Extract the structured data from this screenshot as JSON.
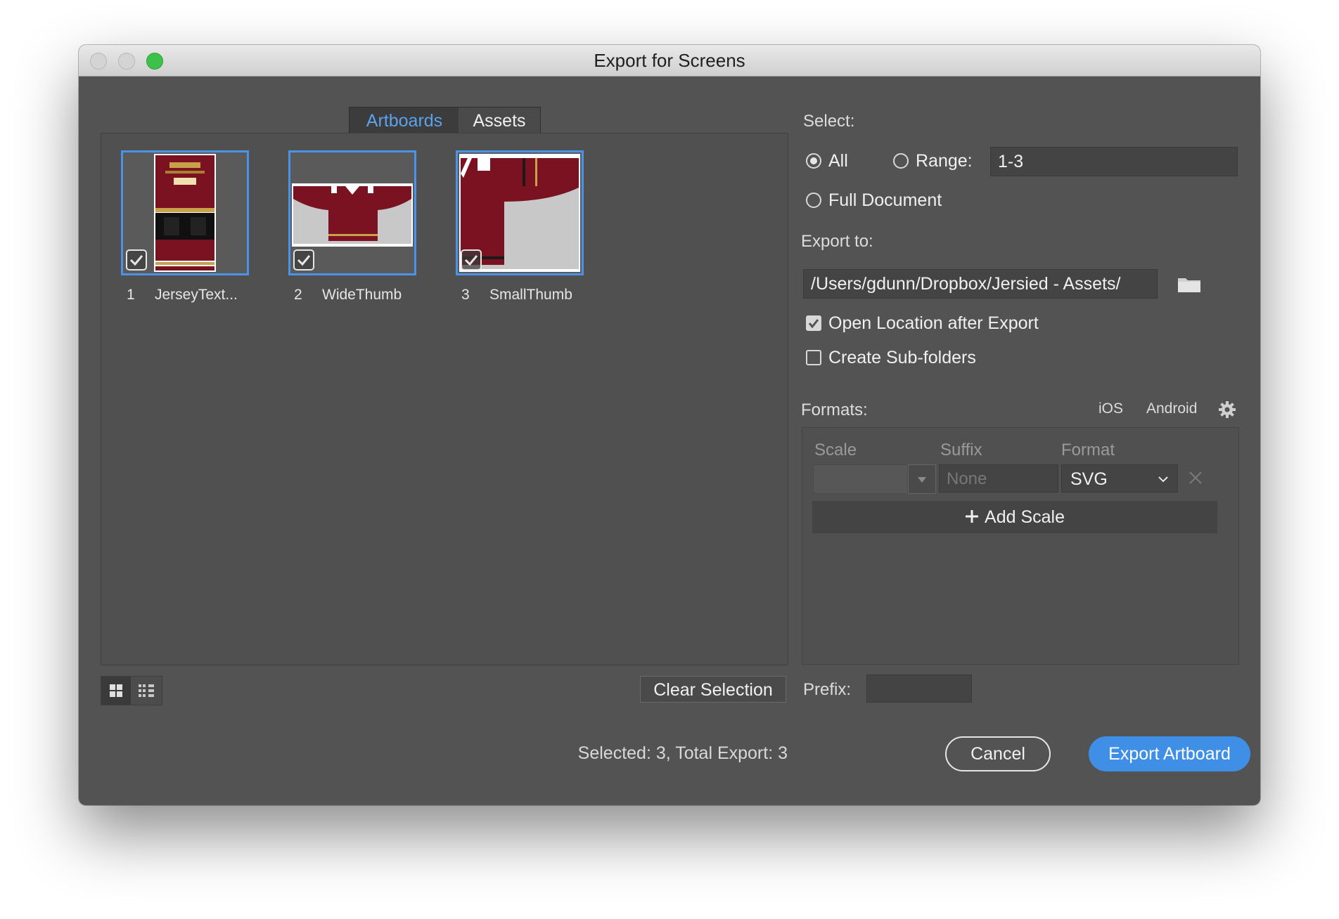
{
  "window": {
    "title": "Export for Screens"
  },
  "tabs": [
    {
      "label": "Artboards",
      "active": true
    },
    {
      "label": "Assets",
      "active": false
    }
  ],
  "artboards": [
    {
      "number": "1",
      "name": "JerseyText...",
      "checked": true
    },
    {
      "number": "2",
      "name": "WideThumb",
      "checked": true
    },
    {
      "number": "3",
      "name": "SmallThumb",
      "checked": true
    }
  ],
  "buttons": {
    "clear_selection": "Clear Selection",
    "cancel": "Cancel",
    "export": "Export Artboard",
    "add_scale": "Add Scale"
  },
  "status": "Selected: 3, Total Export: 3",
  "select": {
    "label": "Select:",
    "all": "All",
    "range": "Range:",
    "range_value": "1-3",
    "full_document": "Full Document",
    "selected": "all"
  },
  "export_to": {
    "label": "Export to:",
    "path": "/Users/gdunn/Dropbox/Jersied - Assets/",
    "open_location": {
      "label": "Open Location after Export",
      "checked": true
    },
    "sub_folders": {
      "label": "Create Sub-folders",
      "checked": false
    }
  },
  "formats": {
    "label": "Formats:",
    "ios": "iOS",
    "android": "Android",
    "columns": {
      "scale": "Scale",
      "suffix": "Suffix",
      "format": "Format"
    },
    "rows": [
      {
        "scale": "",
        "suffix_placeholder": "None",
        "format": "SVG"
      }
    ]
  },
  "prefix": {
    "label": "Prefix:",
    "value": ""
  },
  "colors": {
    "accent": "#3f8fe6",
    "tab_active": "#5aa2ee",
    "background": "#535353",
    "jersey_red": "#7a1222"
  }
}
